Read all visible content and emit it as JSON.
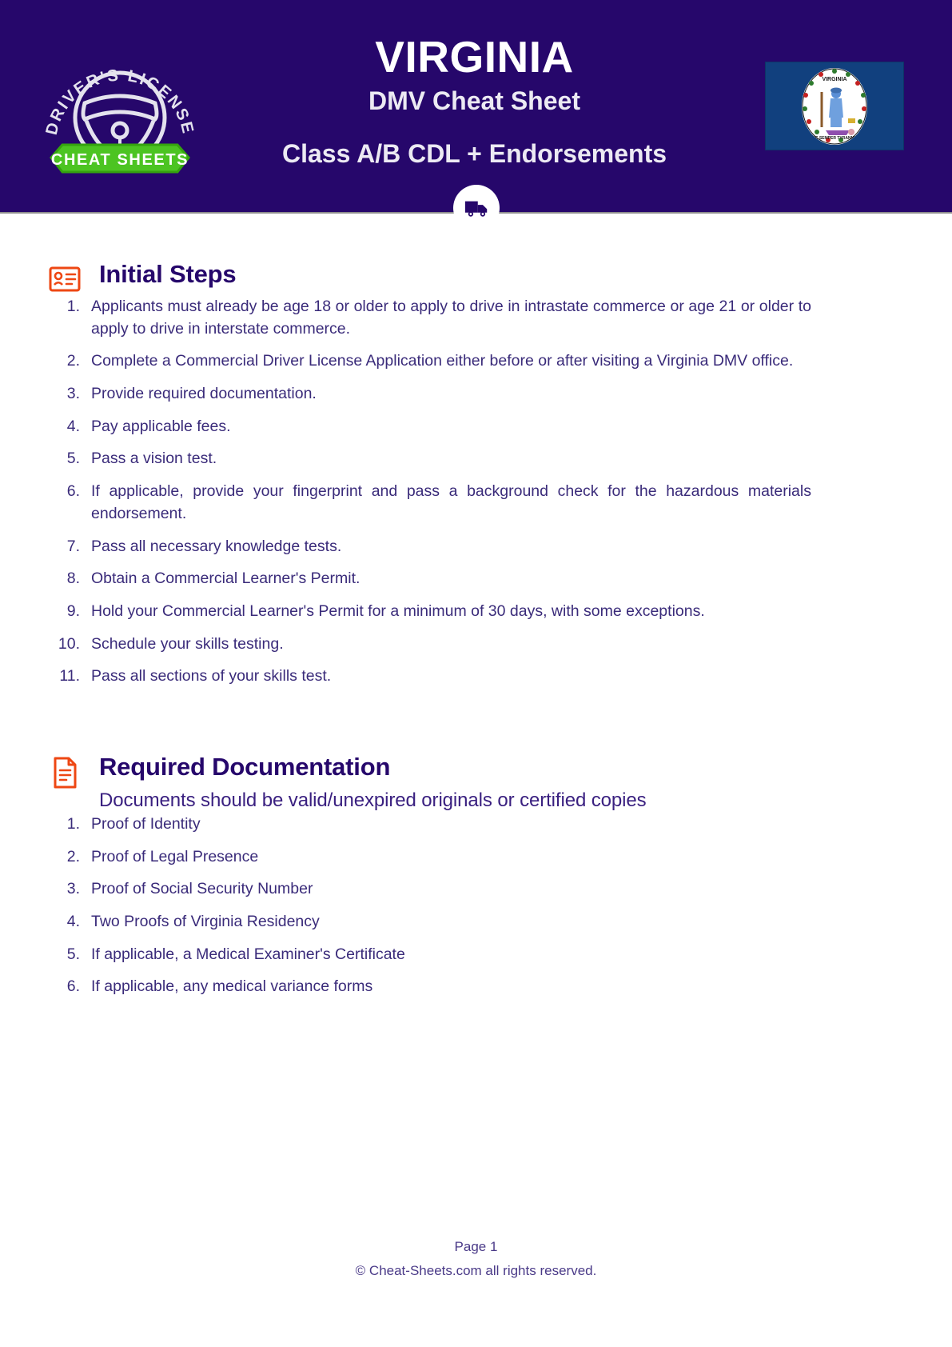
{
  "header": {
    "brand": {
      "arc_text": "DRIVER'S LICENSE",
      "ribbon_text": "CHEAT SHEETS",
      "wheel_icon": "steering-wheel-icon",
      "ribbon_color": "#4cc422"
    },
    "title": "VIRGINIA",
    "subtitle": "DMV Cheat Sheet",
    "third_line": "Class A/B CDL + Endorsements",
    "flag_name": "virginia-state-flag",
    "flag_color": "#11407e",
    "badge_icon": "truck-icon",
    "background_color": "#26076b"
  },
  "sections": [
    {
      "icon": "id-card-icon",
      "icon_color": "#ee4713",
      "title": "Initial Steps",
      "subtitle": "",
      "items": [
        "Applicants must already be age 18 or older to apply to drive in intrastate commerce or age 21 or older to apply to drive in interstate commerce.",
        "Complete a Commercial Driver License Application either before or after visiting a Virginia DMV office.",
        "Provide required documentation.",
        "Pay applicable fees.",
        "Pass a vision test.",
        "If applicable, provide your fingerprint and pass a background check for the hazardous materials endorsement.",
        "Pass all necessary knowledge tests.",
        "Obtain a Commercial Learner's Permit.",
        "Hold your Commercial Learner's Permit for a minimum of 30 days, with some exceptions.",
        "Schedule your skills testing.",
        "Pass all sections of your skills test."
      ]
    },
    {
      "icon": "document-icon",
      "icon_color": "#ee4713",
      "title": "Required Documentation",
      "subtitle": "Documents should be valid/unexpired originals or certified copies",
      "items": [
        "Proof of Identity",
        "Proof of Legal Presence",
        "Proof of Social Security Number",
        "Two Proofs of Virginia Residency",
        "If applicable, a Medical Examiner's Certificate",
        "If applicable, any medical variance forms"
      ]
    }
  ],
  "footer": {
    "page": "Page 1",
    "copyright": "©  Cheat-Sheets.com all rights reserved."
  },
  "colors": {
    "header_bg": "#26076b",
    "accent_orange": "#ee4713",
    "heading_purple": "#26076b",
    "body_purple": "#3a2b7a",
    "ribbon_green": "#4cc422"
  }
}
